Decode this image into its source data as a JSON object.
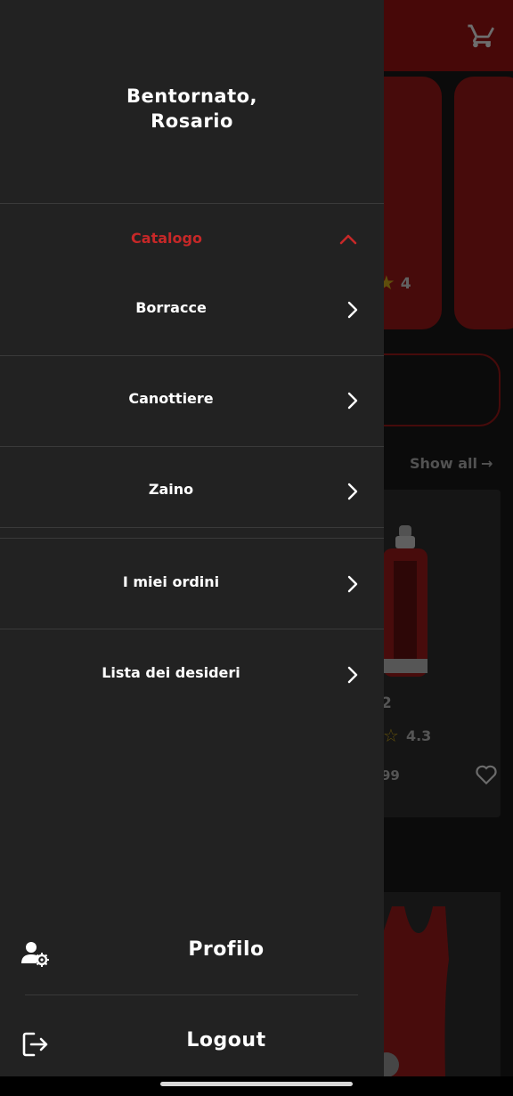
{
  "background": {
    "cart_icon": "shopping-cart-icon",
    "rating_1": "4",
    "show_all": "Show all",
    "product_price_partial": "2",
    "rating_2": "4.3",
    "price_partial": "99",
    "heart_icon": "heart-icon"
  },
  "drawer": {
    "greeting_line1": "Bentornato,",
    "greeting_line2": "Rosario",
    "catalog": {
      "label": "Catalogo",
      "expanded": true,
      "items": [
        {
          "label": "Borracce"
        },
        {
          "label": "Canottiere"
        },
        {
          "label": "Zaino"
        }
      ]
    },
    "menu": [
      {
        "label": "I miei ordini"
      },
      {
        "label": "Lista dei desideri"
      }
    ],
    "profile_label": "Profilo",
    "logout_label": "Logout"
  },
  "colors": {
    "accent": "#c62828",
    "drawer_bg": "#222222",
    "header_bg": "#5c0b0b"
  }
}
